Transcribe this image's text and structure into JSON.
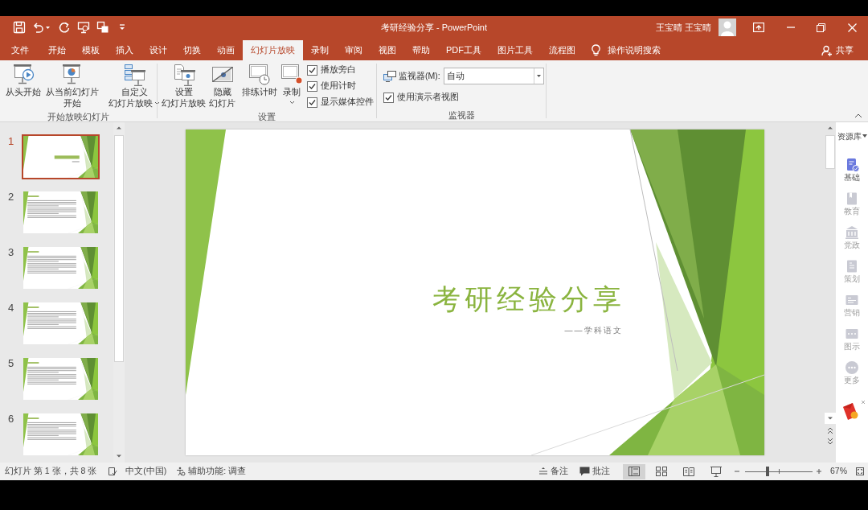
{
  "window": {
    "title": "考研经验分享 - PowerPoint",
    "user": "王宝晴 王宝晴"
  },
  "tabs": [
    {
      "label": "文件",
      "selected": false
    },
    {
      "label": "开始",
      "selected": false
    },
    {
      "label": "模板",
      "selected": false
    },
    {
      "label": "插入",
      "selected": false
    },
    {
      "label": "设计",
      "selected": false
    },
    {
      "label": "切换",
      "selected": false
    },
    {
      "label": "动画",
      "selected": false
    },
    {
      "label": "幻灯片放映",
      "selected": true
    },
    {
      "label": "录制",
      "selected": false
    },
    {
      "label": "审阅",
      "selected": false
    },
    {
      "label": "视图",
      "selected": false
    },
    {
      "label": "帮助",
      "selected": false
    },
    {
      "label": "PDF工具",
      "selected": false
    },
    {
      "label": "图片工具",
      "selected": false
    },
    {
      "label": "流程图",
      "selected": false
    }
  ],
  "tell_me": "操作说明搜索",
  "share": "共享",
  "ribbon": {
    "groups": [
      {
        "label": "开始放映幻灯片",
        "buttons": [
          {
            "lines": [
              "从头开始"
            ]
          },
          {
            "lines": [
              "从当前幻灯片",
              "开始"
            ]
          },
          {
            "lines": [
              "自定义",
              "幻灯片放映"
            ],
            "dropdown": true
          }
        ]
      },
      {
        "label": "设置",
        "buttons": [
          {
            "lines": [
              "设置",
              "幻灯片放映"
            ]
          },
          {
            "lines": [
              "隐藏",
              "幻灯片"
            ]
          },
          {
            "lines": [
              "排练计时"
            ]
          },
          {
            "lines": [
              "录制"
            ],
            "dropdown": true
          }
        ],
        "checkboxes": [
          {
            "label": "播放旁白",
            "checked": true
          },
          {
            "label": "使用计时",
            "checked": true
          },
          {
            "label": "显示媒体控件",
            "checked": true
          }
        ]
      },
      {
        "label": "监视器",
        "monitor": {
          "label": "监视器(M):",
          "value": "自动"
        },
        "checkboxes": [
          {
            "label": "使用演示者视图",
            "checked": true
          }
        ]
      }
    ]
  },
  "slides": [
    {
      "number": "1",
      "kind": "title",
      "selected": true
    },
    {
      "number": "2",
      "kind": "content",
      "selected": false
    },
    {
      "number": "3",
      "kind": "content",
      "selected": false
    },
    {
      "number": "4",
      "kind": "content",
      "selected": false
    },
    {
      "number": "5",
      "kind": "content",
      "selected": false
    },
    {
      "number": "6",
      "kind": "content",
      "selected": false
    }
  ],
  "slide": {
    "title": "考研经验分享",
    "subtitle": "——学科语文"
  },
  "resource_panel": {
    "title": "资源库",
    "items": [
      {
        "label": "基础",
        "selected": true
      },
      {
        "label": "教育",
        "selected": false
      },
      {
        "label": "党政",
        "selected": false
      },
      {
        "label": "策划",
        "selected": false
      },
      {
        "label": "营销",
        "selected": false
      },
      {
        "label": "图示",
        "selected": false
      },
      {
        "label": "更多",
        "selected": false
      }
    ]
  },
  "status_bar": {
    "slide_info": "幻灯片 第 1 张，共 8 张",
    "language": "中文(中国)",
    "accessibility": "辅助功能: 调查",
    "notes": "备注",
    "comments": "批注",
    "views": [
      {
        "kind": "normal",
        "selected": true
      },
      {
        "kind": "sorter",
        "selected": false
      },
      {
        "kind": "reading",
        "selected": false
      },
      {
        "kind": "slideshow",
        "selected": false
      }
    ],
    "zoom": {
      "level": 0.32,
      "reading": "67%"
    }
  }
}
